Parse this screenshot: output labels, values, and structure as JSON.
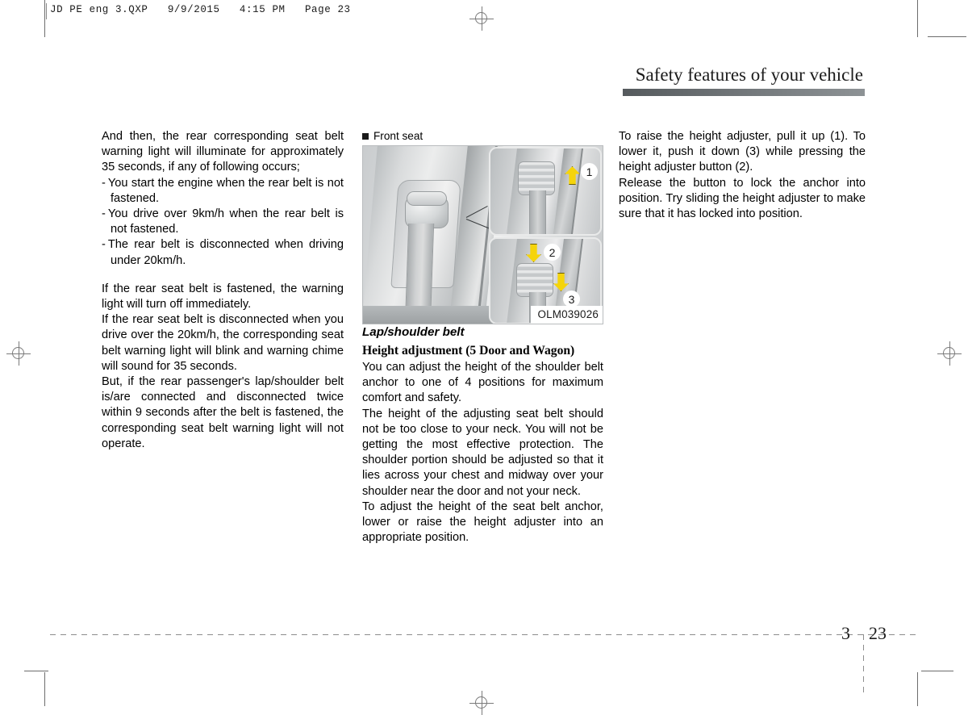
{
  "print_marks": {
    "source_header": "JD PE eng 3.QXP   9/9/2015   4:15 PM   Page 23"
  },
  "chapter": {
    "title": "Safety features of your vehicle"
  },
  "columns": {
    "left": {
      "paragraph_1": "And then, the rear corresponding seat belt warning light will illuminate for approximately 35 seconds, if any of following occurs;",
      "bullets": [
        "You start the engine when the rear belt is not fastened.",
        "You drive over 9km/h when the rear belt is not fastened.",
        "The rear belt is disconnected when driving under 20km/h."
      ],
      "bullet_dash": "-",
      "paragraph_2": "If the rear seat belt is fastened, the warning light will turn off immediately.",
      "paragraph_3": "If the rear seat belt is disconnected when you drive over the 20km/h, the corresponding seat belt warning light will blink and warning chime will sound for 35 seconds.",
      "paragraph_4": "But, if the rear passenger's lap/shoulder belt is/are connected and disconnected twice within 9 seconds after the belt is fastened, the corresponding seat belt warning light will not operate."
    },
    "middle": {
      "figure": {
        "label": "Front seat",
        "code": "OLM039026",
        "callouts": [
          {
            "number": "1",
            "direction": "up"
          },
          {
            "number": "2",
            "direction": "down"
          },
          {
            "number": "3",
            "direction": "down"
          }
        ]
      },
      "heading_italic": "Lap/shoulder belt",
      "heading_serif": "Height adjustment (5 Door and Wagon)",
      "paragraph_1": "You can adjust the height of the shoulder belt anchor to one of 4 positions for maximum comfort and safety.",
      "paragraph_2": "The height of the adjusting seat belt should not be too close to your neck. You will not be getting the most effective protection. The shoulder portion should be adjusted so that it lies across your chest and midway over your shoulder near the door and not your neck.",
      "paragraph_3": "To adjust the height of the seat belt anchor, lower or raise the height adjuster into an appropriate position."
    },
    "right": {
      "paragraph_1": "To raise the height adjuster, pull it up (1). To lower it, push it down (3) while pressing the height adjuster button (2).",
      "paragraph_2": "Release the button to lock the anchor into position. Try sliding the height adjuster  to make sure that it has locked into position."
    }
  },
  "footer": {
    "chapter_number": "3",
    "page_number": "23"
  }
}
